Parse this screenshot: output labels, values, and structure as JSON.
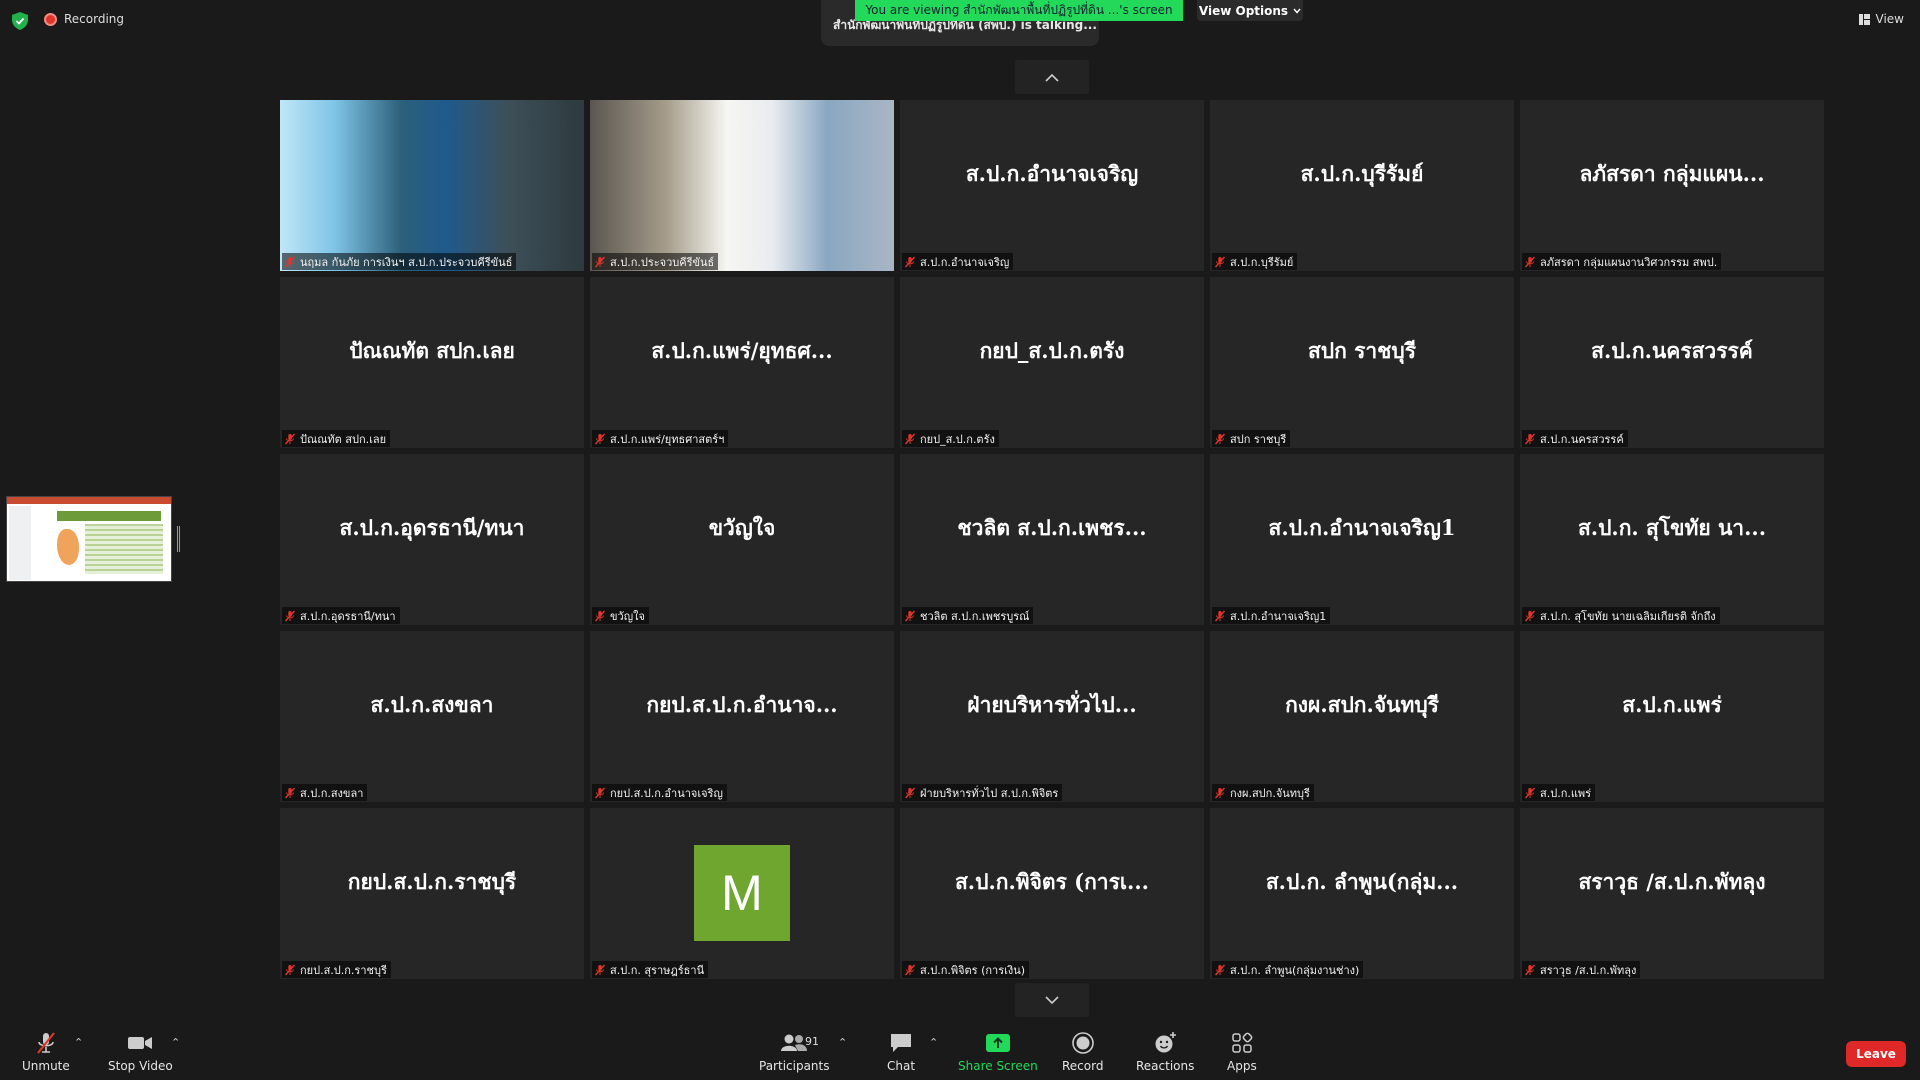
{
  "top": {
    "recording_label": "Recording",
    "talking_text": "สำนักพัฒนาพื้นที่ปฏิรูปที่ดิน (สพป.) is talking...",
    "viewing_text": "You are viewing สำนักพัฒนาพื้นที่ปฏิรูปที่ดิน ...'s screen",
    "view_options_label": "View Options",
    "view_label": "View"
  },
  "tiles": [
    {
      "display": "",
      "name": "นฤมล กันภัย การเงินฯ ส.ป.ก.ประจวบคีรีขันธ์",
      "kind": "camera1"
    },
    {
      "display": "",
      "name": "ส.ป.ก.ประจวบคีรีขันธ์",
      "kind": "camera2"
    },
    {
      "display": "ส.ป.ก.อำนาจเจริญ",
      "name": "ส.ป.ก.อำนาจเจริญ",
      "kind": "name"
    },
    {
      "display": "ส.ป.ก.บุรีรัมย์",
      "name": "ส.ป.ก.บุรีรัมย์",
      "kind": "name"
    },
    {
      "display": "ลภัสรดา กลุ่มแผน...",
      "name": "ลภัสรดา กลุ่มแผนงานวิศวกรรม สพป.",
      "kind": "name"
    },
    {
      "display": "ปัณณทัต สปก.เลย",
      "name": "ปัณณทัต สปก.เลย",
      "kind": "name"
    },
    {
      "display": "ส.ป.ก.แพร่/ยุทธศ...",
      "name": "ส.ป.ก.แพร่/ยุทธศาสตร์ฯ",
      "kind": "name"
    },
    {
      "display": "กยป_ส.ป.ก.ตรัง",
      "name": "กยป_ส.ป.ก.ตรัง",
      "kind": "name"
    },
    {
      "display": "สปก ราชบุรี",
      "name": "สปก ราชบุรี",
      "kind": "name"
    },
    {
      "display": "ส.ป.ก.นครสวรรค์",
      "name": "ส.ป.ก.นครสวรรค์",
      "kind": "name"
    },
    {
      "display": "ส.ป.ก.อุดรธานี/ทนา",
      "name": "ส.ป.ก.อุดรธานี/ทนา",
      "kind": "name"
    },
    {
      "display": "ขวัญใจ",
      "name": "ขวัญใจ",
      "kind": "name"
    },
    {
      "display": "ชวลิต ส.ป.ก.เพชร...",
      "name": "ชวลิต ส.ป.ก.เพชรบูรณ์",
      "kind": "name"
    },
    {
      "display": "ส.ป.ก.อำนาจเจริญ1",
      "name": "ส.ป.ก.อำนาจเจริญ1",
      "kind": "name"
    },
    {
      "display": "ส.ป.ก. สุโขทัย นา...",
      "name": "ส.ป.ก. สุโขทัย นายเฉลิมเกียรติ จักถึง",
      "kind": "name"
    },
    {
      "display": "ส.ป.ก.สงขลา",
      "name": "ส.ป.ก.สงขลา",
      "kind": "name"
    },
    {
      "display": "กยป.ส.ป.ก.อำนาจ...",
      "name": "กยป.ส.ป.ก.อำนาจเจริญ",
      "kind": "name"
    },
    {
      "display": "ฝ่ายบริหารทั่วไป...",
      "name": "ฝ่ายบริหารทั่วไป ส.ป.ก.พิจิตร",
      "kind": "name"
    },
    {
      "display": "กงผ.สปก.จันทบุรี",
      "name": "กงผ.สปก.จันทบุรี",
      "kind": "name"
    },
    {
      "display": "ส.ป.ก.แพร่",
      "name": "ส.ป.ก.แพร่",
      "kind": "name"
    },
    {
      "display": "กยป.ส.ป.ก.ราชบุรี",
      "name": "กยป.ส.ป.ก.ราชบุรี",
      "kind": "name"
    },
    {
      "display": "M",
      "name": "ส.ป.ก. สุราษฎร์ธานี",
      "kind": "avatar"
    },
    {
      "display": "ส.ป.ก.พิจิตร (การเ...",
      "name": "ส.ป.ก.พิจิตร (การเงิน)",
      "kind": "name"
    },
    {
      "display": "ส.ป.ก. ลำพูน(กลุ่ม...",
      "name": "ส.ป.ก. ลำพูน(กลุ่มงานช่าง)",
      "kind": "name"
    },
    {
      "display": "สราวุธ /ส.ป.ก.พัทลุง",
      "name": "สราวุธ /ส.ป.ก.พัทลุง",
      "kind": "name"
    }
  ],
  "toolbar": {
    "unmute": "Unmute",
    "stop_video": "Stop Video",
    "participants": "Participants",
    "participants_count": "91",
    "chat": "Chat",
    "share_screen": "Share Screen",
    "record": "Record",
    "reactions": "Reactions",
    "apps": "Apps",
    "leave": "Leave"
  },
  "colors": {
    "background": "#1a1a1a",
    "tile": "#262626",
    "banner_green": "#23d959",
    "leave_red": "#e02828",
    "muted_red": "#e0352b",
    "avatar_green": "#6fa62f"
  }
}
